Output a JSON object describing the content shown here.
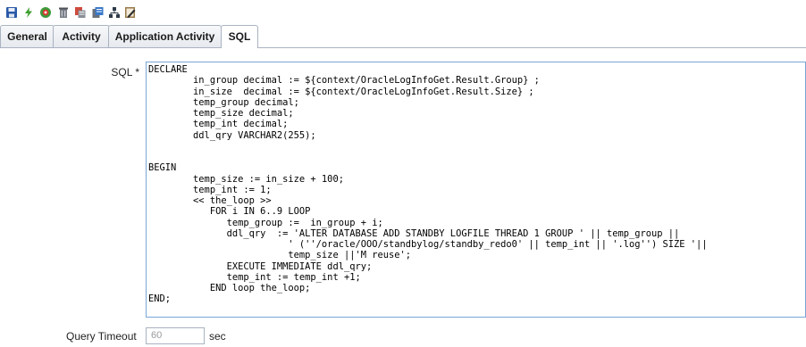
{
  "toolbar": {
    "icons": [
      "save-icon",
      "refresh-icon",
      "database-icon",
      "delete-icon",
      "copy-icon",
      "paste-icon",
      "hierarchy-icon",
      "edit-icon"
    ]
  },
  "tabs": [
    {
      "label": "General",
      "active": false
    },
    {
      "label": "Activity",
      "active": false
    },
    {
      "label": "Application Activity",
      "active": false
    },
    {
      "label": "SQL",
      "active": true
    }
  ],
  "sql": {
    "label": "SQL *",
    "value": "DECLARE\n        in_group decimal := ${context/OracleLogInfoGet.Result.Group} ;\n        in_size  decimal := ${context/OracleLogInfoGet.Result.Size} ;\n        temp_group decimal;\n        temp_size decimal;\n        temp_int decimal;\n        ddl_qry VARCHAR2(255);\n\n\nBEGIN\n        temp_size := in_size + 100;\n        temp_int := 1;\n        << the_loop >>\n           FOR i IN 6..9 LOOP\n              temp_group :=  in_group + i;\n              ddl_qry  := 'ALTER DATABASE ADD STANDBY LOGFILE THREAD 1 GROUP ' || temp_group ||\n                         ' (''/oracle/OOO/standbylog/standby_redo0' || temp_int || '.log'') SIZE '||\n                         temp_size ||'M reuse';\n              EXECUTE IMMEDIATE ddl_qry;\n              temp_int := temp_int +1;\n           END loop the_loop;\nEND;"
  },
  "query_timeout": {
    "label": "Query Timeout",
    "value": "60",
    "unit": "sec"
  }
}
